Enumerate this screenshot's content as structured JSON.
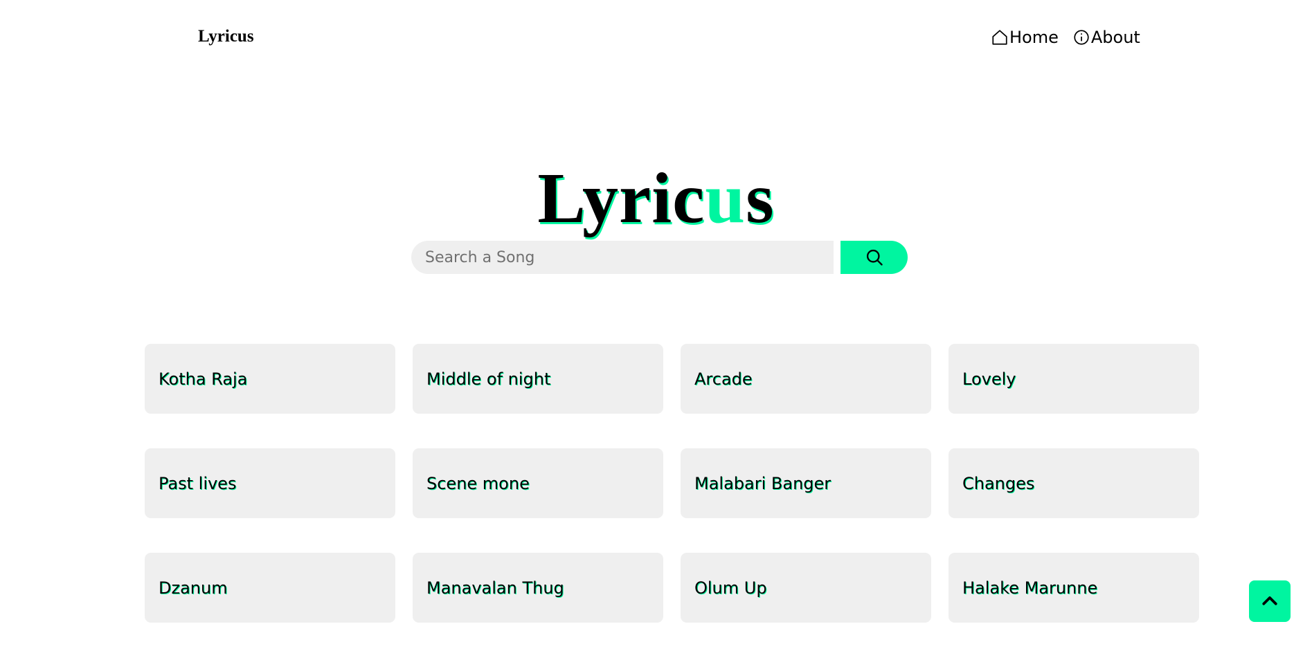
{
  "header": {
    "brand": "Lyricus",
    "nav": [
      {
        "label": "Home",
        "icon": "home-icon"
      },
      {
        "label": "About",
        "icon": "info-icon"
      }
    ]
  },
  "hero": {
    "title_part1": "Lyric",
    "title_accent": "u",
    "title_part2": "s",
    "accent_color": "#00f5a0"
  },
  "search": {
    "placeholder": "Search a Song",
    "button_icon": "search-icon"
  },
  "songs": [
    "Kotha Raja",
    "Middle of night",
    "Arcade",
    "Lovely",
    "Past lives",
    "Scene mone",
    "Malabari Banger",
    "Changes",
    "Dzanum",
    "Manavalan Thug",
    "Olum Up",
    "Halake Marunne"
  ],
  "back_to_top": {
    "icon": "chevron-up-icon"
  }
}
